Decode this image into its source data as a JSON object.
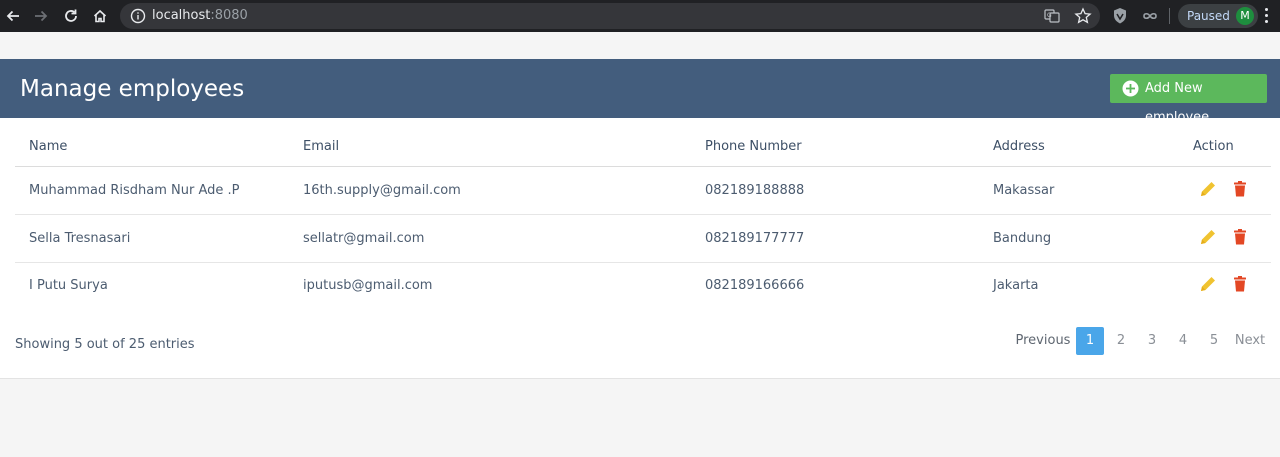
{
  "browser": {
    "url_host": "localhost",
    "url_port": ":8080",
    "profile_status": "Paused",
    "profile_initial": "M"
  },
  "page": {
    "title": "Manage employees",
    "add_button_label": "Add New employee",
    "columns": [
      "Name",
      "Email",
      "Phone Number",
      "Address",
      "Action"
    ],
    "rows": [
      {
        "name": "Muhammad Risdham Nur Ade .P",
        "email": "16th.supply@gmail.com",
        "phone": "082189188888",
        "address": "Makassar"
      },
      {
        "name": "Sella Tresnasari",
        "email": "sellatr@gmail.com",
        "phone": "082189177777",
        "address": "Bandung"
      },
      {
        "name": "I Putu Surya",
        "email": "iputusb@gmail.com",
        "phone": "082189166666",
        "address": "Jakarta"
      }
    ],
    "entries_hint": "Showing 5 out of 25 entries",
    "pagination": {
      "previous": "Previous",
      "pages": [
        "1",
        "2",
        "3",
        "4",
        "5"
      ],
      "active_page": "1",
      "next": "Next"
    }
  },
  "colors": {
    "header_bg": "#435d7d",
    "add_button": "#5cb85c",
    "edit_icon": "#f0c330",
    "delete_icon": "#e34724",
    "active_page": "#4aa6e9"
  }
}
